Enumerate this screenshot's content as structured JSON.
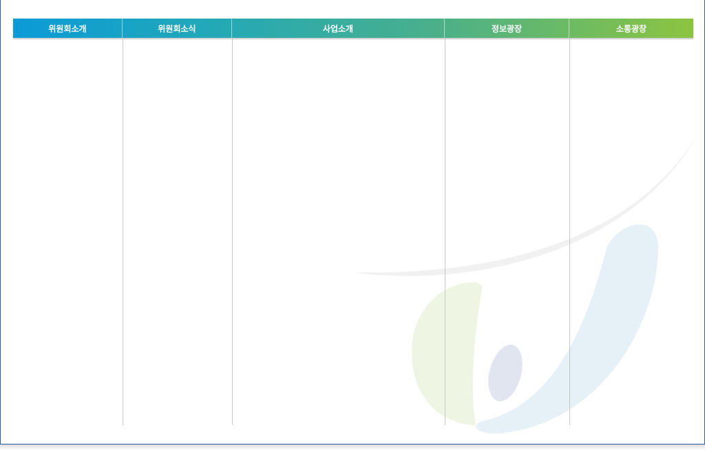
{
  "nav": {
    "items": [
      {
        "label": "위원회소개"
      },
      {
        "label": "위원회소식"
      },
      {
        "label": "사업소개"
      },
      {
        "label": "정보광장"
      },
      {
        "label": "소통광장"
      }
    ]
  },
  "colors": {
    "nav_start": "#0b9ad8",
    "nav_end": "#8cc440",
    "frame_border": "#2e5aa6"
  }
}
